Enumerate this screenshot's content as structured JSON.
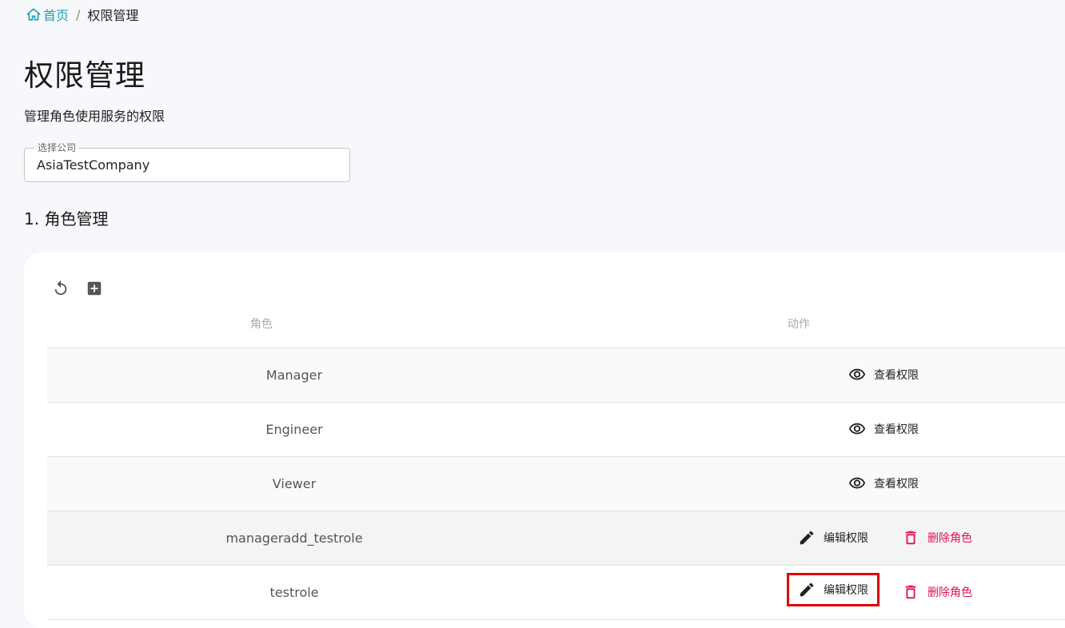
{
  "breadcrumb": {
    "home": "首页",
    "separator": "/",
    "current": "权限管理"
  },
  "page": {
    "title": "权限管理",
    "description": "管理角色使用服务的权限"
  },
  "company_select": {
    "label": "选择公司",
    "value": "AsiaTestCompany"
  },
  "section": {
    "title": "1. 角色管理"
  },
  "toolbar": {
    "icons": [
      "refresh-icon",
      "add-box-icon"
    ]
  },
  "table": {
    "headers": {
      "role": "角色",
      "action": "动作"
    },
    "rows": [
      {
        "role": "Manager",
        "actions": [
          "view"
        ]
      },
      {
        "role": "Engineer",
        "actions": [
          "view"
        ]
      },
      {
        "role": "Viewer",
        "actions": [
          "view"
        ]
      },
      {
        "role": "manageradd_testrole",
        "actions": [
          "edit",
          "delete"
        ]
      },
      {
        "role": "testrole",
        "actions": [
          "edit",
          "delete"
        ],
        "edit_highlighted": true
      }
    ]
  },
  "actions": {
    "view_label": "查看权限",
    "edit_label": "编辑权限",
    "delete_label": "删除角色"
  },
  "colors": {
    "accent": "#1aa3b8",
    "danger": "#e0105c",
    "highlight": "#e00000"
  }
}
